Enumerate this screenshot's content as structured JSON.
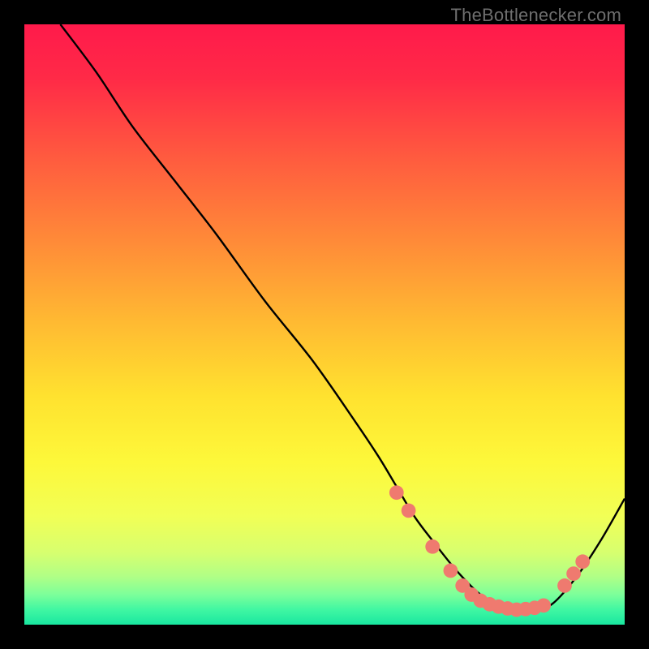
{
  "watermark": "TheBottlenecker.com",
  "chart_data": {
    "type": "line",
    "title": "",
    "xlabel": "",
    "ylabel": "",
    "xlim": [
      0,
      100
    ],
    "ylim": [
      0,
      100
    ],
    "grid": false,
    "background_gradient": [
      {
        "stop": 0.0,
        "color": "#ff1a4b"
      },
      {
        "stop": 0.09,
        "color": "#ff2a47"
      },
      {
        "stop": 0.22,
        "color": "#ff5a3f"
      },
      {
        "stop": 0.36,
        "color": "#ff8a38"
      },
      {
        "stop": 0.5,
        "color": "#ffbb32"
      },
      {
        "stop": 0.62,
        "color": "#ffe22f"
      },
      {
        "stop": 0.73,
        "color": "#fdf83a"
      },
      {
        "stop": 0.82,
        "color": "#f1ff56"
      },
      {
        "stop": 0.88,
        "color": "#d7ff6f"
      },
      {
        "stop": 0.92,
        "color": "#b0ff86"
      },
      {
        "stop": 0.95,
        "color": "#7cff9a"
      },
      {
        "stop": 0.975,
        "color": "#40f7a2"
      },
      {
        "stop": 1.0,
        "color": "#19e7a0"
      }
    ],
    "series": [
      {
        "name": "bottleneck-curve",
        "color": "#000000",
        "x": [
          6,
          12,
          18,
          25,
          32,
          40,
          48,
          55,
          59,
          62,
          65,
          68,
          72,
          76,
          80,
          82,
          85,
          88,
          92,
          96,
          100
        ],
        "y": [
          100,
          92,
          83,
          74,
          65,
          54,
          44,
          34,
          28,
          23,
          18,
          14,
          9,
          5,
          2.8,
          2.2,
          2.4,
          3.5,
          8,
          14,
          21
        ]
      }
    ],
    "markers": {
      "name": "bottleneck-dots",
      "color": "#ef7a6f",
      "radius_pct": 1.2,
      "points": [
        {
          "x": 62,
          "y": 22
        },
        {
          "x": 64,
          "y": 19
        },
        {
          "x": 68,
          "y": 13
        },
        {
          "x": 71,
          "y": 9
        },
        {
          "x": 73,
          "y": 6.5
        },
        {
          "x": 74.5,
          "y": 5
        },
        {
          "x": 76,
          "y": 4
        },
        {
          "x": 77.5,
          "y": 3.4
        },
        {
          "x": 79,
          "y": 3.0
        },
        {
          "x": 80.5,
          "y": 2.7
        },
        {
          "x": 82,
          "y": 2.5
        },
        {
          "x": 83.5,
          "y": 2.6
        },
        {
          "x": 85,
          "y": 2.8
        },
        {
          "x": 86.5,
          "y": 3.2
        },
        {
          "x": 90,
          "y": 6.5
        },
        {
          "x": 91.5,
          "y": 8.5
        },
        {
          "x": 93,
          "y": 10.5
        }
      ]
    }
  }
}
